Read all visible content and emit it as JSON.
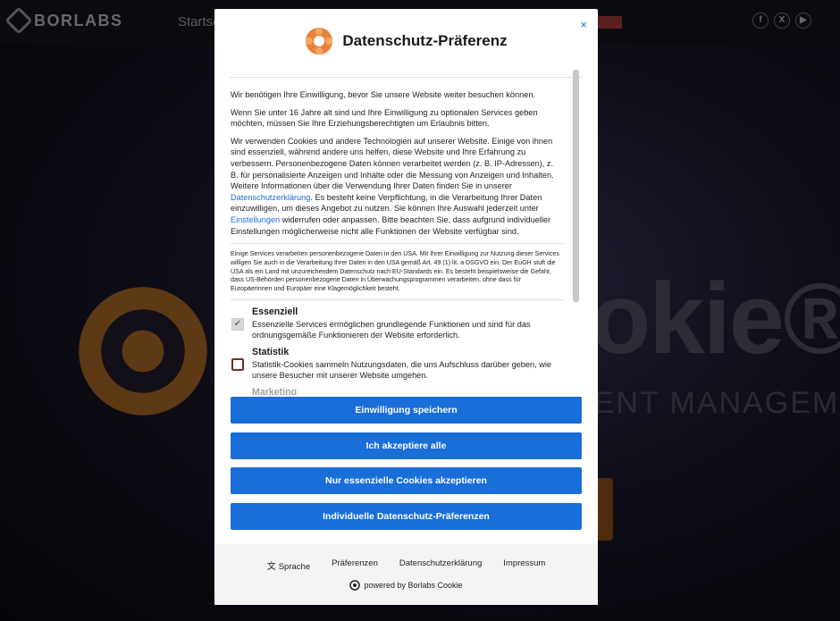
{
  "background": {
    "brand": "BORLABS",
    "nav_item": "Startse",
    "social": [
      "f",
      "X",
      "▶"
    ],
    "big_text": "okie®",
    "sub_text": "SENT MANAGEMEN"
  },
  "dialog": {
    "title": "Datenschutz-Präferenz",
    "close_label": "×",
    "intro": "Wir benötigen Ihre Einwilligung, bevor Sie unsere Website weiter besuchen können.",
    "age": "Wenn Sie unter 16 Jahre alt sind und Ihre Einwilligung zu optionalen Services geben möchten, müssen Sie Ihre Erziehungsberechtigten um Erlaubnis bitten.",
    "body_1": "Wir verwenden Cookies und andere Technologien auf unserer Website. Einige von ihnen sind essenziell, während andere uns helfen, diese Website und Ihre Erfahrung zu verbessern. Personenbezogene Daten können verarbeitet werden (z. B. IP-Adressen), z. B. für personalisierte Anzeigen und Inhalte oder die Messung von Anzeigen und Inhalten. Weitere Informationen über die Verwendung Ihrer Daten finden Sie in unserer ",
    "privacy_link": "Datenschutzerklärung",
    "body_2": ". Es besteht keine Verpflichtung, in die Verarbeitung Ihrer Daten einzuwilligen, um dieses Angebot zu nutzen. Sie können Ihre Auswahl jederzeit unter ",
    "settings_link": "Einstellungen",
    "body_3": " widerrufen oder anpassen. Bitte beachten Sie, dass aufgrund individueller Einstellungen möglicherweise nicht alle Funktionen der Website verfügbar sind.",
    "usa_notice": "Einige Services verarbeiten personenbezogene Daten in den USA. Mit Ihrer Einwilligung zur Nutzung dieser Services willigen Sie auch in die Verarbeitung Ihrer Daten in den USA gemäß Art. 49 (1) lit. a DSGVO ein. Der EuGH stuft die USA als ein Land mit unzureichendem Datenschutz nach EU-Standards ein. Es besteht beispielsweise die Gefahr, dass US-Behörden personenbezogene Daten in Überwachungsprogrammen verarbeiten, ohne dass für Europäerinnen und Europäer eine Klagemöglichkeit besteht.",
    "categories": [
      {
        "title": "Essenziell",
        "description": "Essenzielle Services ermöglichen grundlegende Funktionen und sind für das ordnungsgemäße Funktionieren der Website erforderlich.",
        "checked": true
      },
      {
        "title": "Statistik",
        "description": "Statistik-Cookies sammeln Nutzungsdaten, die uns Aufschluss darüber geben, wie unsere Besucher mit unserer Website umgehen.",
        "checked": false
      },
      {
        "title": "Marketing",
        "description": "",
        "checked": false
      }
    ],
    "buttons": {
      "save": "Einwilligung speichern",
      "accept_all": "Ich akzeptiere alle",
      "essential_only": "Nur essenzielle Cookies akzeptieren",
      "individual": "Individuelle Datenschutz-Präferenzen"
    },
    "footer": {
      "language": "Sprache",
      "preferences": "Präferenzen",
      "privacy": "Datenschutzerklärung",
      "imprint": "Impressum",
      "powered": "powered by Borlabs Cookie"
    },
    "colors": {
      "accent": "#1a6ed8",
      "logo": "#e8823a",
      "footer_bg": "#f4f4f4"
    }
  }
}
